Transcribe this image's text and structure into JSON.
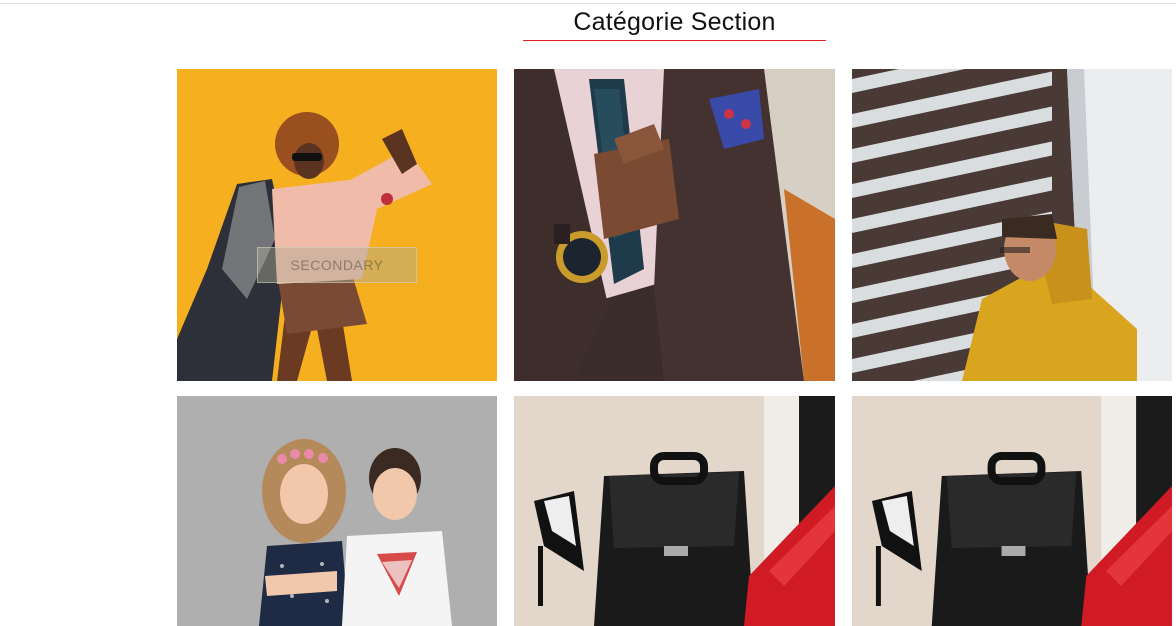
{
  "section": {
    "title": "Catégorie Section"
  },
  "categories": [
    {
      "name": "woman-dancing-yellow",
      "button_label": "SECONDARY"
    },
    {
      "name": "man-suit-watch"
    },
    {
      "name": "man-yellow-hoodie-building"
    },
    {
      "name": "children-portrait"
    },
    {
      "name": "handbag-red-shoes"
    },
    {
      "name": "handbag-red-shoes-2"
    }
  ],
  "colors": {
    "accent_underline": "#dd2222",
    "tile1_bg": "#f5a91a",
    "tile3_hoodie": "#d9a41e"
  }
}
